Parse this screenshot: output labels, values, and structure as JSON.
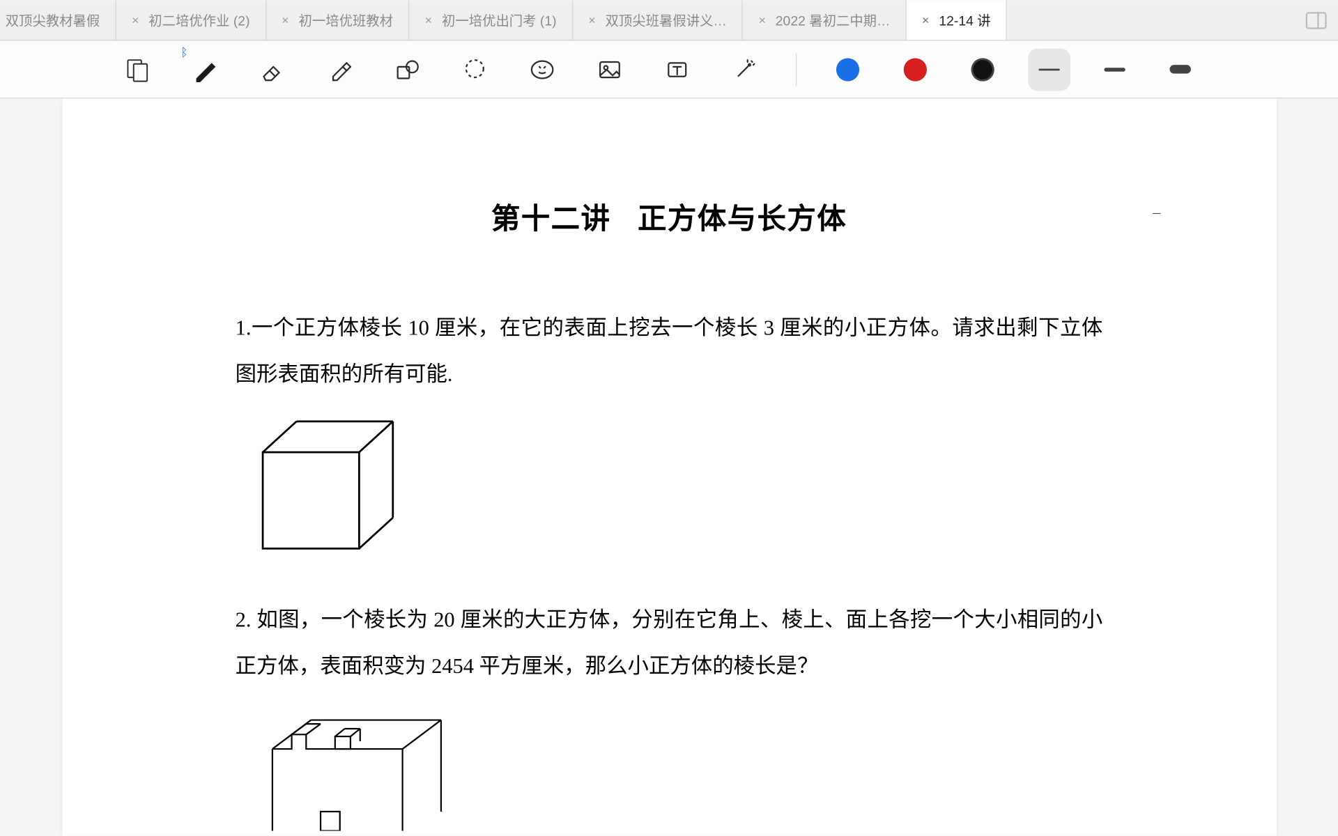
{
  "tabs": [
    {
      "label": "双顶尖教材暑假",
      "closable": false
    },
    {
      "label": "初二培优作业 (2)",
      "closable": true
    },
    {
      "label": "初一培优班教材",
      "closable": true
    },
    {
      "label": "初一培优出门考 (1)",
      "closable": true
    },
    {
      "label": "双顶尖班暑假讲义…",
      "closable": true
    },
    {
      "label": "2022 暑初二中期…",
      "closable": true
    },
    {
      "label": "12-14 讲",
      "closable": true,
      "active": true
    }
  ],
  "doc": {
    "title_a": "第十二讲",
    "title_b": "正方体与长方体",
    "p1": "1.一个正方体棱长 10 厘米，在它的表面上挖去一个棱长 3 厘米的小正方体。请求出剩下立体图形表面积的所有可能.",
    "p2": "2. 如图，一个棱长为 20 厘米的大正方体，分别在它角上、棱上、面上各挖一个大小相同的小正方体，表面积变为 2454 平方厘米，那么小正方体的棱长是？",
    "minus": "–"
  },
  "colors": {
    "blue": "#1b6fe5",
    "red": "#d62020",
    "black": "#111111"
  }
}
